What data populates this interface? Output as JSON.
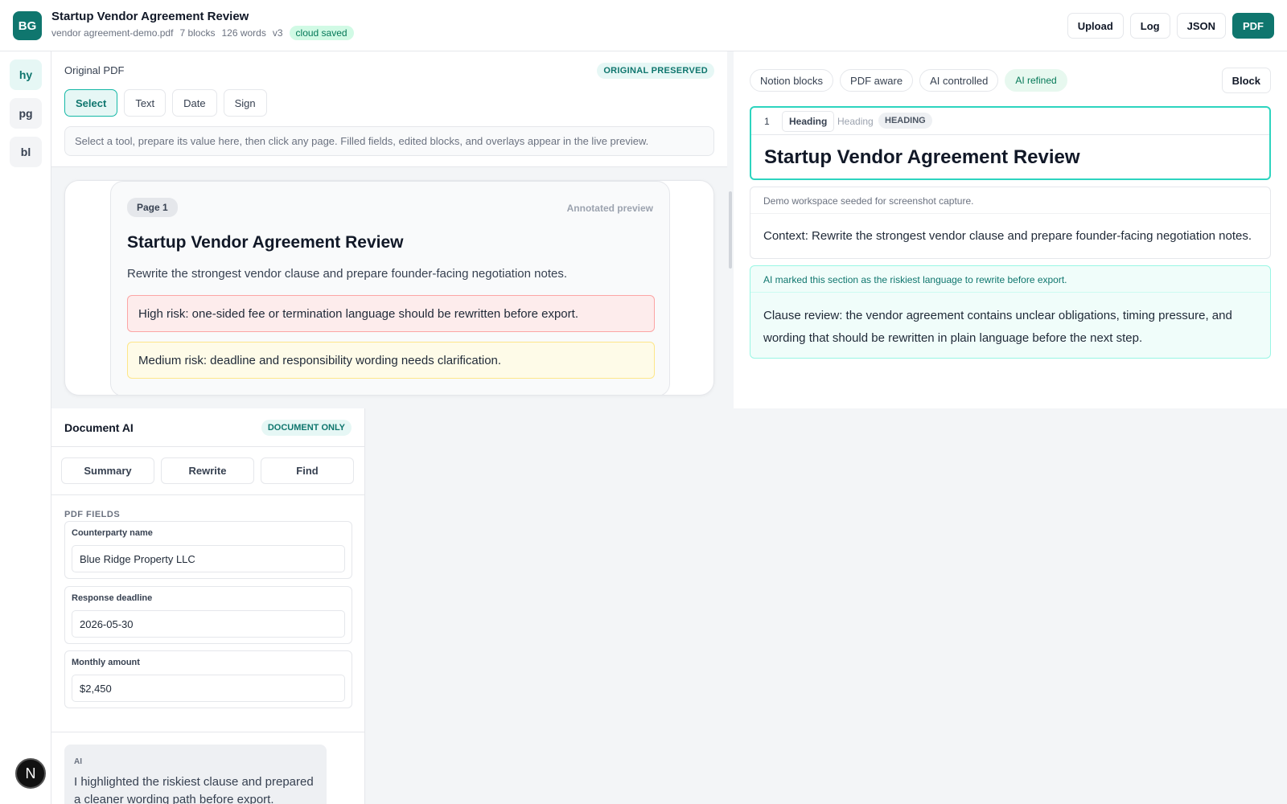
{
  "header": {
    "logo": "BG",
    "title": "Startup Vendor Agreement Review",
    "file": "vendor agreement-demo.pdf",
    "blocks": "7 blocks",
    "words": "126 words",
    "version": "v3",
    "saved": "cloud saved",
    "buttons": {
      "upload": "Upload",
      "log": "Log",
      "json": "JSON",
      "pdf": "PDF"
    }
  },
  "rail": {
    "items": [
      "hy",
      "pg",
      "bl"
    ],
    "active": "hy",
    "bottom_icon": "N"
  },
  "pdf": {
    "label": "Original PDF",
    "badge": "ORIGINAL PRESERVED",
    "tools": [
      "Select",
      "Text",
      "Date",
      "Sign"
    ],
    "active_tool": "Select",
    "hint": "Select a tool, prepare its value here, then click any page. Filled fields, edited blocks, and overlays appear in the live preview.",
    "page": {
      "badge": "Page 1",
      "annotation": "Annotated preview",
      "title": "Startup Vendor Agreement Review",
      "text": "Rewrite the strongest vendor clause and prepare founder-facing negotiation notes.",
      "high_risk": "High risk: one-sided fee or termination language should be rewritten before export.",
      "medium_risk": "Medium risk: deadline and responsibility wording needs clarification."
    }
  },
  "editor": {
    "chips": [
      "Notion blocks",
      "PDF aware",
      "AI controlled",
      "AI refined"
    ],
    "block_button": "Block",
    "block1": {
      "num": "1",
      "type_select": "Heading",
      "type_hint": "Heading",
      "tag": "HEADING",
      "title": "Startup Vendor Agreement Review"
    },
    "block2": {
      "note": "Demo workspace seeded for screenshot capture.",
      "text": "Context: Rewrite the strongest vendor clause and prepare founder-facing negotiation notes."
    },
    "block3": {
      "note": "AI marked this section as the riskiest language to rewrite before export.",
      "text": "Clause review: the vendor agreement contains unclear obligations, timing pressure, and wording that should be rewritten in plain language before the next step."
    }
  },
  "docai": {
    "title": "Document AI",
    "badge": "DOCUMENT ONLY",
    "tabs": [
      "Summary",
      "Rewrite",
      "Find"
    ],
    "fields_label": "PDF FIELDS",
    "fields": [
      {
        "label": "Counterparty name",
        "value": "Blue Ridge Property LLC"
      },
      {
        "label": "Response deadline",
        "value": "2026-05-30"
      },
      {
        "label": "Monthly amount",
        "value": "$2,450"
      }
    ],
    "ai": {
      "tag": "AI",
      "text": "I highlighted the riskiest clause and prepared a cleaner wording path before export."
    }
  },
  "colors": {
    "accent": "#0f766e",
    "high_risk_bg": "#fdecec",
    "medium_risk_bg": "#fefbe8",
    "ai_bg": "#f0fdfa"
  }
}
